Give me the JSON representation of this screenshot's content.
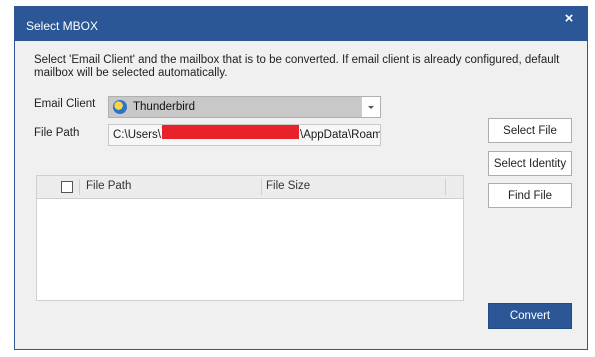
{
  "dialog": {
    "title": "Select MBOX",
    "close": "×",
    "description": "Select 'Email Client' and the mailbox that is to be converted. If email client is already configured, default mailbox will be selected automatically."
  },
  "form": {
    "email_client_label": "Email Client",
    "email_client_value": "Thunderbird",
    "file_path_label": "File Path",
    "file_path_prefix": "C:\\Users\\",
    "file_path_suffix": "\\AppData\\Roamin"
  },
  "buttons": {
    "select_file": "Select File",
    "select_identity": "Select Identity",
    "find_file": "Find File",
    "convert": "Convert"
  },
  "grid": {
    "columns": [
      "File Path",
      "File Size"
    ],
    "rows": []
  },
  "colors": {
    "accent": "#2b5797",
    "redaction": "#e8212a"
  },
  "icons": {
    "email_client": "thunderbird-icon",
    "dropdown": "chevron-down-icon",
    "close": "close-icon"
  }
}
